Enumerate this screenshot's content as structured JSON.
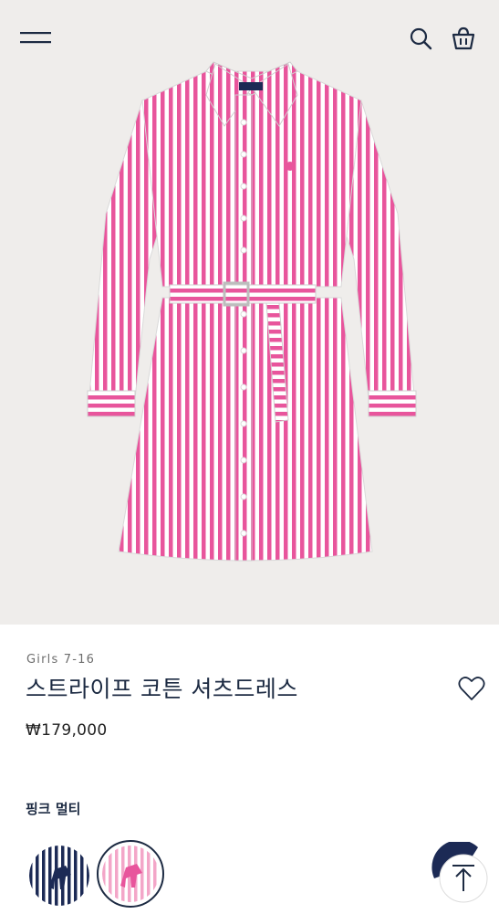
{
  "header": {
    "menu_icon": "hamburger-menu-icon",
    "search_icon": "search-icon",
    "bag_icon": "shopping-bag-icon"
  },
  "product": {
    "category": "Girls 7-16",
    "title": "스트라이프 코튼 셔츠드레스",
    "price": "₩179,000",
    "color_name": "핑크 멀티",
    "wishlist_icon": "heart-icon",
    "image": "pink-white-striped-shirtdress",
    "swatches": [
      {
        "name": "navy-stripe",
        "selected": false,
        "color": "#1c2a55"
      },
      {
        "name": "pink-stripe",
        "selected": true,
        "color": "#e8559c"
      }
    ]
  },
  "colors": {
    "navy": "#1c2a42",
    "pink": "#e8559c",
    "background": "#efedeb"
  },
  "scroll_top_icon": "arrow-up-icon"
}
